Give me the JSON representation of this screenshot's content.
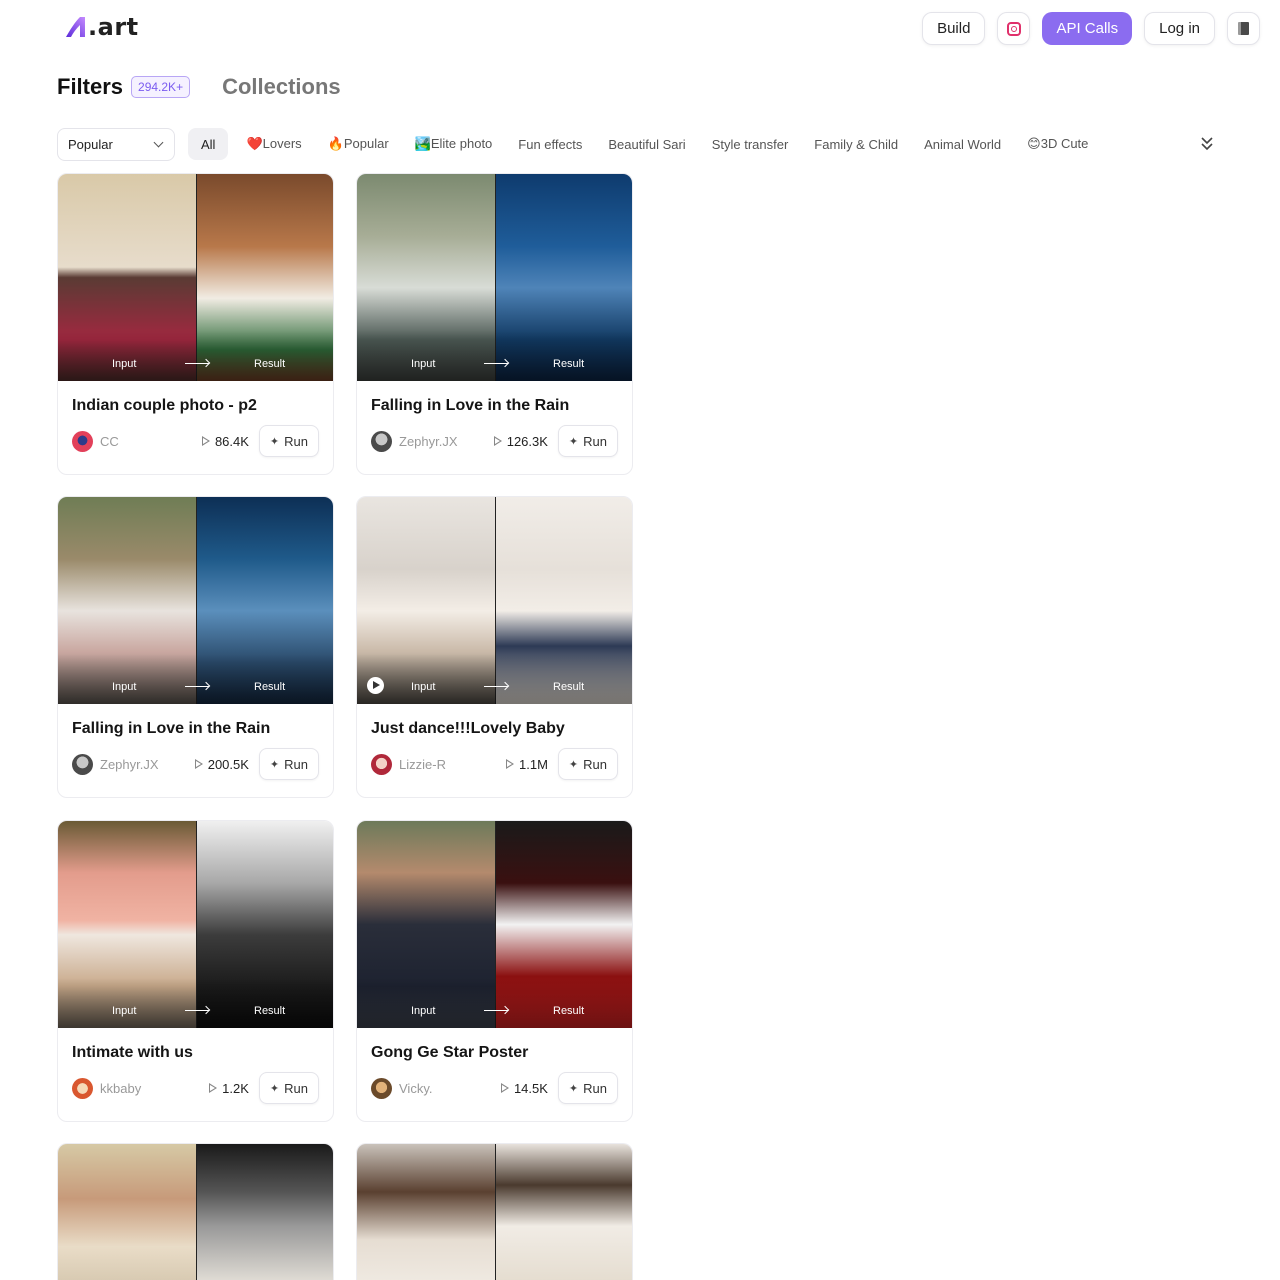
{
  "header": {
    "logo_text": ".art",
    "build_label": "Build",
    "instagram_icon": "instagram-icon",
    "api_label": "API Calls",
    "login_label": "Log in",
    "book_icon": "book-icon",
    "accent": "#8b6cf0"
  },
  "tabs": {
    "filters_label": "Filters",
    "filters_count": "294.2K+",
    "collections_label": "Collections"
  },
  "filter_bar": {
    "sort_value": "Popular",
    "chips": [
      "All",
      "❤️Lovers",
      "🔥Popular",
      "🏞️Elite photo",
      "Fun effects",
      "Beautiful Sari",
      "Style transfer",
      "Family & Child",
      "Animal World",
      "😊3D Cute"
    ]
  },
  "card_labels": {
    "input": "Input",
    "result": "Result",
    "run": "Run"
  },
  "cards": [
    {
      "title": "Indian couple photo - p2",
      "author": "CC",
      "runs": "86.4K"
    },
    {
      "title": "Falling in Love in the Rain",
      "author": "Zephyr.JX",
      "runs": "126.3K"
    },
    {
      "title": "Falling in Love in the Rain",
      "author": "Zephyr.JX",
      "runs": "200.5K"
    },
    {
      "title": "Just dance!!!Lovely Baby",
      "author": "Lizzie-R",
      "runs": "1.1M"
    },
    {
      "title": "Intimate with us",
      "author": "kkbaby",
      "runs": "1.2K"
    },
    {
      "title": "Gong Ge Star Poster",
      "author": "Vicky.",
      "runs": "14.5K"
    }
  ]
}
